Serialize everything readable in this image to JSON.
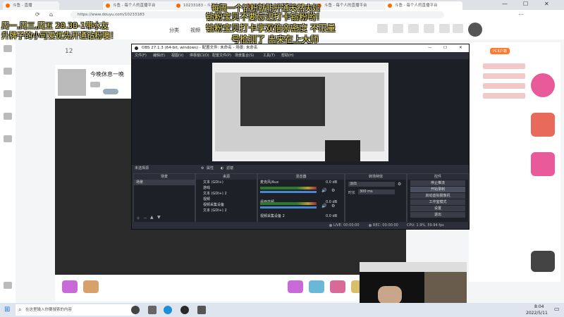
{
  "browser": {
    "tabs": [
      {
        "label": "斗鱼 - 直播"
      },
      {
        "label": "斗鱼 - 每个人的直播平台"
      },
      {
        "label": "10233183 - 斗鱼直播"
      },
      {
        "label": "斗鱼 - 每个人的直播平台"
      },
      {
        "label": "斗鱼 - 每个人的直播平台"
      },
      {
        "label": "斗鱼 - 每个人的直播平台"
      }
    ],
    "url": "https://www.douyu.com/10233183"
  },
  "overlay": {
    "line1": "每周一个钻粉就能开通天然夫妇",
    "line2": "钻粉宝贝不要忘记打卡钻粉哟！",
    "line3": "钻粉宝贝打卡享双倍亲密度 不限量",
    "line4": "号检测了 出来在上大师",
    "left1": "周一,周三,周五 20.30-1带水友",
    "left2": "升牌子的小可爱优先开通钻粉噢！"
  },
  "page": {
    "nav_fenlei": "分类",
    "nav_shipin": "视频",
    "room_title": "今晚休息一晚",
    "follower_count": "12",
    "fans_badge": "PCK户端"
  },
  "obs": {
    "title": "OBS 27.1.3 (64-bit, windows) - 配置文件: 未命名 - 场景: 未命名",
    "menu": [
      "文件(F)",
      "编辑(E)",
      "视图(V)",
      "停靠窗口(D)",
      "配置文件(P)",
      "场景集合(S)",
      "工具(T)",
      "帮助(H)"
    ],
    "no_source": "未选择源",
    "props_btn": "属性",
    "filter_btn": "滤镜",
    "docks": {
      "scenes": "场景",
      "sources": "来源",
      "mixer": "混音器",
      "transitions": "转场特效",
      "controls": "控件"
    },
    "scene_item": "场景",
    "sources": [
      "文本 (GDI+)",
      "游戏",
      "文本 (GDI+) 2",
      "视频",
      "视频采集设备",
      "文本 (GDI+) 2"
    ],
    "mixer": [
      {
        "name": "麦克风/Aux",
        "db": "0.0 dB"
      },
      {
        "name": "桌面音频",
        "db": "0.0 dB"
      },
      {
        "name": "视频采集设备 2",
        "db": "0.0 dB"
      }
    ],
    "transition": {
      "type": "淡出",
      "duration_label": "时长",
      "duration": "300 ms"
    },
    "controls": [
      "停止推流",
      "开始录制",
      "启动虚拟摄像机",
      "工作室模式",
      "设置",
      "退出"
    ],
    "status": {
      "live": "LIVE: 00:00:00",
      "rec": "REC: 00:00:00",
      "cpu": "CPU: 1.9%, 59.94 fps"
    }
  },
  "taskbar": {
    "search_placeholder": "在这里输入你要搜索的内容",
    "time": "8:04",
    "date": "2022/5/11"
  }
}
